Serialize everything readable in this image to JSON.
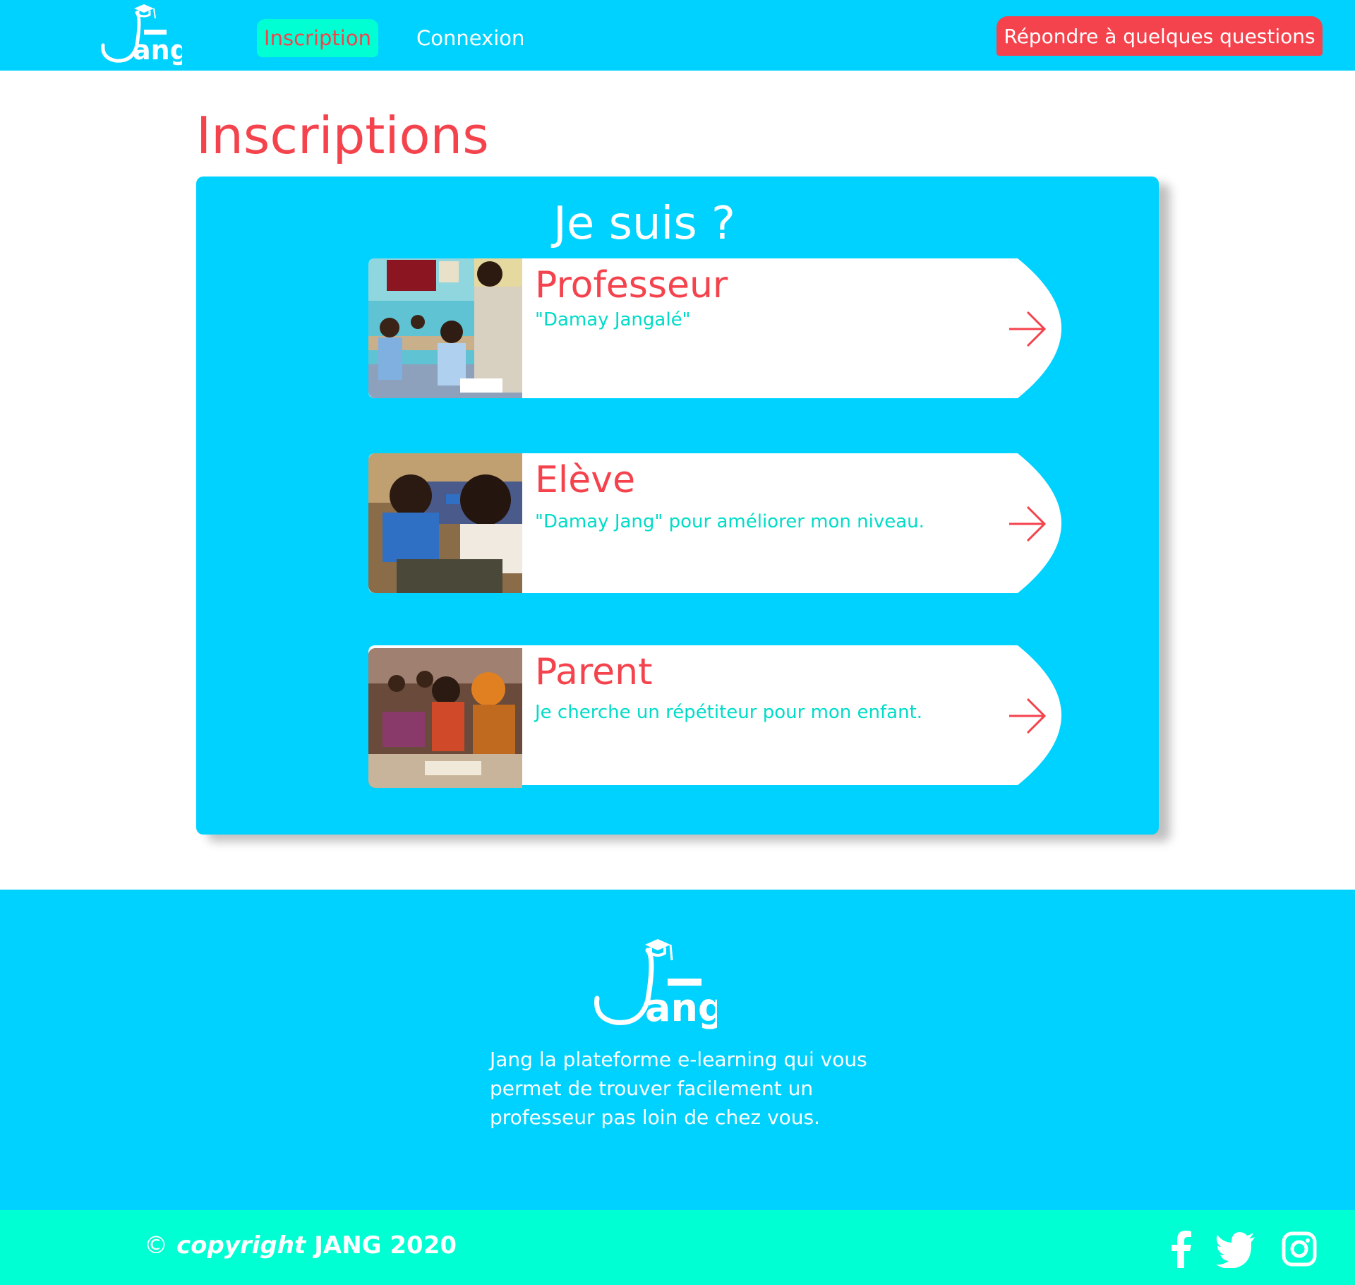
{
  "colors": {
    "primary_blue": "#00d2ff",
    "accent_teal": "#00ffd2",
    "accent_red": "#f4434d",
    "subtitle_teal": "#00dcc8",
    "white": "#ffffff"
  },
  "header": {
    "logo_text": "Jang",
    "nav": {
      "inscription": "Inscription",
      "connexion": "Connexion"
    },
    "cta": "Répondre à quelques questions"
  },
  "main": {
    "title": "Inscriptions",
    "panel_title": "Je suis ?",
    "cards": [
      {
        "title": "Professeur",
        "subtitle": "\"Damay Jangalé\"",
        "icon": "arrow-right-icon"
      },
      {
        "title": "Elève",
        "subtitle": "\"Damay Jang\" pour améliorer mon niveau.",
        "icon": "arrow-right-icon"
      },
      {
        "title": "Parent",
        "subtitle": "Je cherche un répétiteur pour mon enfant.",
        "icon": "arrow-right-icon"
      }
    ]
  },
  "footer": {
    "logo_text": "Jang",
    "description": "Jang la plateforme e-learning qui vous permet de trouver facilement un professeur pas loin de chez vous.",
    "copyright_symbol": "©",
    "copyright_word": "copyright",
    "copyright_brand": "JANG 2020",
    "social": [
      "facebook-icon",
      "twitter-icon",
      "instagram-icon"
    ]
  }
}
